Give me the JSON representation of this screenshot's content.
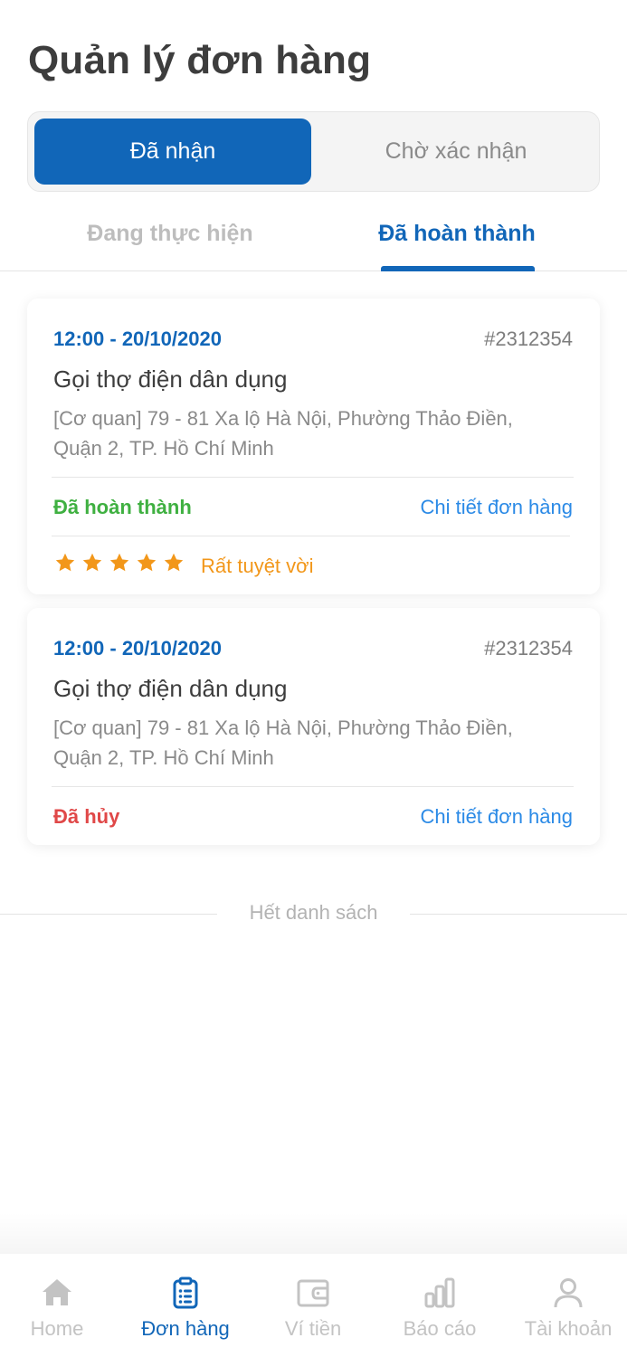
{
  "header": {
    "title": "Quản lý đơn hàng"
  },
  "segments": {
    "active": "Đã nhận",
    "inactive": "Chờ xác nhận"
  },
  "subtabs": {
    "left": "Đang thực hiện",
    "right": "Đã hoàn thành"
  },
  "orders": [
    {
      "time": "12:00 - 20/10/2020",
      "id": "#2312354",
      "service": "Gọi thợ điện dân dụng",
      "address": "[Cơ quan] 79 - 81 Xa lộ Hà Nội, Phường Thảo Điền, Quận 2, TP. Hồ Chí Minh",
      "status": "Đã hoàn thành",
      "detail_link": "Chi tiết đơn hàng",
      "rating": 5,
      "rating_text": "Rất tuyệt vời"
    },
    {
      "time": "12:00 - 20/10/2020",
      "id": "#2312354",
      "service": "Gọi thợ điện dân dụng",
      "address": "[Cơ quan] 79 - 81 Xa lộ Hà Nội, Phường Thảo Điền, Quận 2, TP. Hồ Chí Minh",
      "status": "Đã hủy",
      "detail_link": "Chi tiết đơn hàng"
    }
  ],
  "end_of_list": "Hết danh sách",
  "nav": {
    "home": "Home",
    "orders": "Đơn hàng",
    "wallet": "Ví tiền",
    "reports": "Báo cáo",
    "account": "Tài khoản"
  },
  "colors": {
    "primary": "#1166b8",
    "completed": "#3fb041",
    "cancelled": "#e04848",
    "link": "#2b8ae6",
    "star": "#f2971a"
  }
}
